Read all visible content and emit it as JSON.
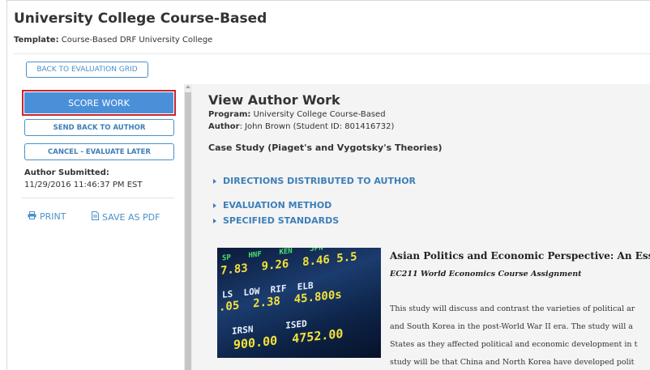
{
  "header": {
    "title": "University College Course-Based",
    "template_label": "Template:",
    "template_value": "Course-Based DRF University College"
  },
  "toolbar": {
    "back_label": "BACK TO EVALUATION GRID"
  },
  "sidebar": {
    "score_label": "SCORE WORK",
    "send_back_label": "SEND BACK TO AUTHOR",
    "cancel_label": "CANCEL - EVALUATE LATER",
    "submitted_label": "Author Submitted:",
    "submitted_value": "11/29/2016 11:46:37 PM EST",
    "print_label": "PRINT",
    "save_pdf_label": "SAVE AS PDF"
  },
  "content": {
    "view_title": "View Author Work",
    "program_label": "Program:",
    "program_value": "University College Course-Based",
    "author_label": "Author",
    "author_value": ": John Brown (Student ID: 801416732)",
    "case_study": "Case Study (Piaget's and Vygotsky's Theories)",
    "sections": [
      "DIRECTIONS DISTRIBUTED TO AUTHOR",
      "EVALUATION METHOD",
      "SPECIFIED STANDARDS"
    ]
  },
  "essay": {
    "title": "Asian Politics and Economic Perspective: An Essay",
    "subtitle": "EC211 World Economics Course Assignment",
    "lines": [
      "This study will discuss and contrast the varieties of political ar",
      "and South Korea in the post-World War II era. The study will a",
      "States as they affected political and economic development in t",
      "study will be that China and North Korea have developed polit"
    ]
  },
  "colors": {
    "accent": "#4a90d9",
    "link": "#3d7fb8",
    "highlight_outline": "#c8252c",
    "content_bg": "#f4f4f4"
  },
  "icons": {
    "print": "printer-icon",
    "save_pdf": "pdf-file-icon",
    "section": "caret-right-icon"
  }
}
